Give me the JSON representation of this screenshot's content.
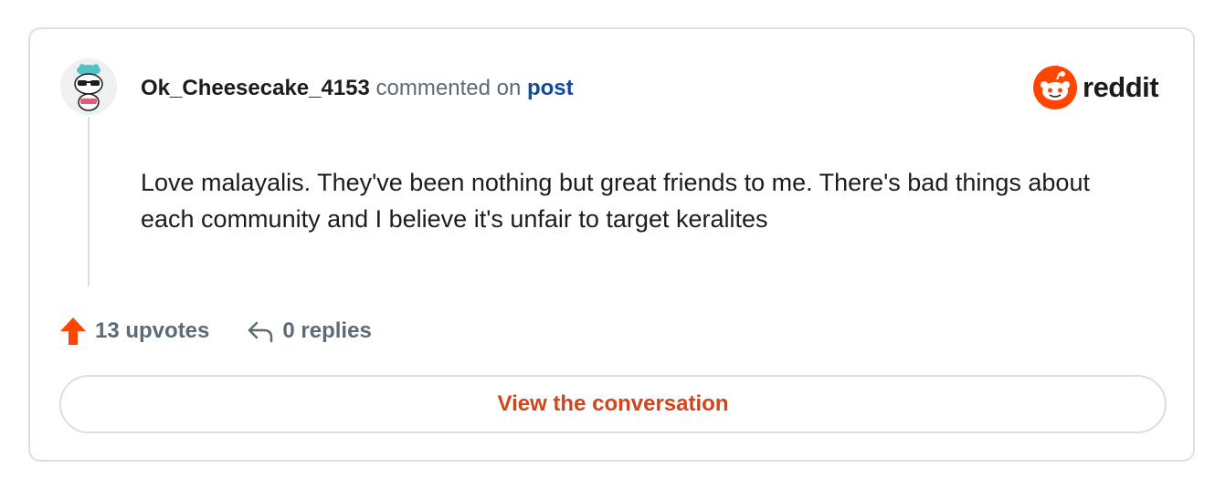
{
  "comment": {
    "username": "Ok_Cheesecake_4153",
    "action_text": "commented on",
    "post_link": "post",
    "body": "Love malayalis. They've been nothing but great friends to me. There's bad things about each community and I believe it's unfair to target keralites"
  },
  "brand": {
    "name": "reddit",
    "icon": "reddit-snoo-icon",
    "color": "#ff4500"
  },
  "stats": {
    "upvotes_label": "13 upvotes",
    "upvote_icon": "upvote-arrow-icon",
    "upvote_color": "#ff4500",
    "replies_label": "0 replies",
    "reply_icon": "reply-arrow-icon"
  },
  "cta": {
    "label": "View the conversation",
    "color": "#d2451a"
  }
}
